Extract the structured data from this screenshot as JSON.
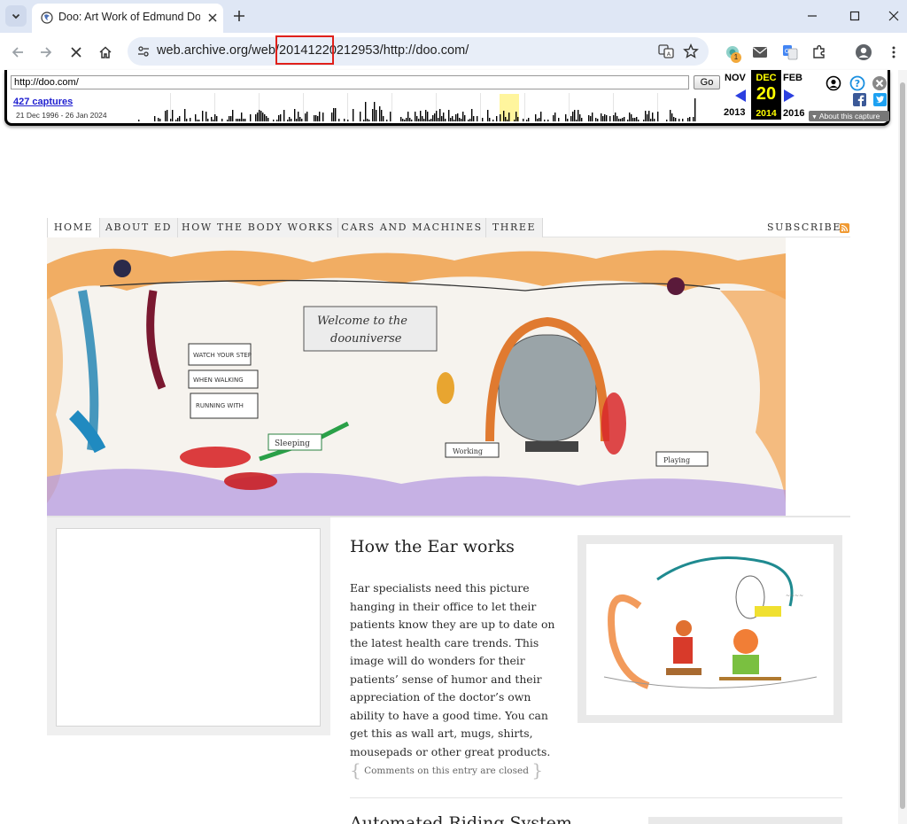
{
  "browser": {
    "tab_title": "Doo: Art Work of Edmund Do",
    "url_prefix": "web.archive.org/web/",
    "url_timestamp": "20141220212953",
    "url_suffix": "/http://doo.com/",
    "extension_badge": "1"
  },
  "wayback": {
    "url_value": "http://doo.com/",
    "go_label": "Go",
    "captures_label": "427 captures",
    "date_range": "21 Dec 1996 - 26 Jan 2024",
    "prev_month": "NOV",
    "prev_year": "2013",
    "current_month": "DEC",
    "current_day": "20",
    "current_year": "2014",
    "next_month": "FEB",
    "next_year": "2016",
    "about_label": "About this capture"
  },
  "site": {
    "nav": [
      "HOME",
      "ABOUT ED",
      "HOW THE BODY WORKS",
      "CARS AND MACHINES",
      "THREE"
    ],
    "subscribe_label": "SUBSCRIBE",
    "post": {
      "title": "How the Ear works",
      "body": "Ear specialists need this picture hanging in their office to let their patients know they are up to date on the latest health care trends. This image will do wonders for their patients’ sense of humor and their appreciation of the doctor’s own ability to have a good time. You can get this as wall art, mugs, shirts, mousepads or other great products.",
      "comments": "Comments on this entry are closed"
    },
    "next_post_title": "Automated Riding System"
  },
  "colors": {
    "tabstrip": "#dfe7f5",
    "wayback_yellow": "#ffff00",
    "link_blue": "#2020d0",
    "highlight_red": "#e0201a",
    "rss_orange": "#f09a33"
  }
}
